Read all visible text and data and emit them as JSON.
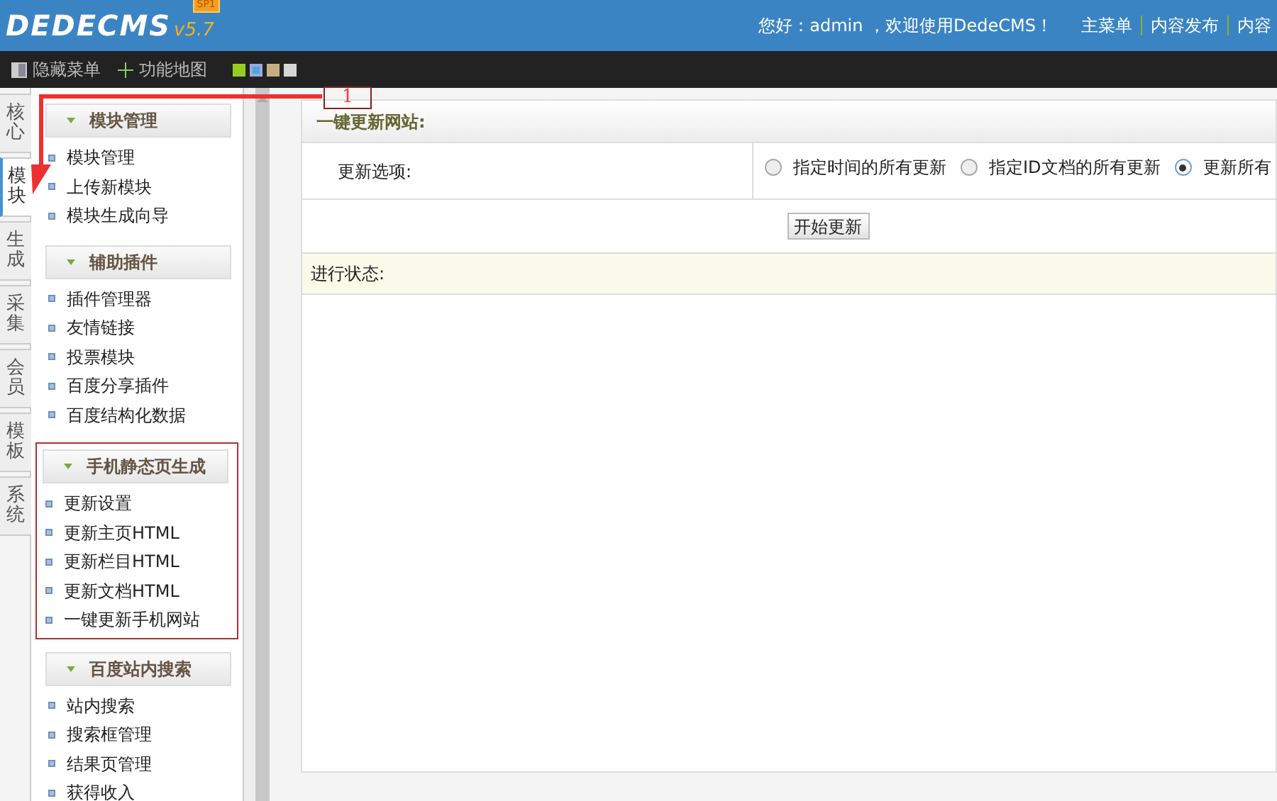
{
  "header": {
    "logo": "DEDECMS",
    "badge": "SP1",
    "version": "v5.7",
    "greeting": "您好：admin ，欢迎使用DedeCMS！",
    "nav": [
      "主菜单",
      "内容发布",
      "内容"
    ]
  },
  "toolbar": {
    "items": [
      {
        "label": "隐藏菜单",
        "kind": "hide"
      },
      {
        "label": "功能地图",
        "kind": "map"
      }
    ],
    "swatches": [
      {
        "color": "#99cc22",
        "selected": false
      },
      {
        "color": "#4aa6dc",
        "selected": true
      },
      {
        "color": "#c6ae84",
        "selected": false
      },
      {
        "color": "#d6d6d6",
        "selected": false
      }
    ]
  },
  "tabs": [
    {
      "label": "核心",
      "selected": false
    },
    {
      "label": "模块",
      "selected": true
    },
    {
      "label": "生成",
      "selected": false
    },
    {
      "label": "采集",
      "selected": false
    },
    {
      "label": "会员",
      "selected": false
    },
    {
      "label": "模板",
      "selected": false
    },
    {
      "label": "系统",
      "selected": false
    }
  ],
  "groups": [
    {
      "title": "模块管理",
      "highlighted": false,
      "items": [
        "模块管理",
        "上传新模块",
        "模块生成向导"
      ]
    },
    {
      "title": "辅助插件",
      "highlighted": false,
      "items": [
        "插件管理器",
        "友情链接",
        "投票模块",
        "百度分享插件",
        "百度结构化数据"
      ]
    },
    {
      "title": "手机静态页生成",
      "highlighted": true,
      "items": [
        "更新设置",
        "更新主页HTML",
        "更新栏目HTML",
        "更新文档HTML",
        "一键更新手机网站"
      ]
    },
    {
      "title": "百度站内搜索",
      "highlighted": false,
      "items": [
        "站内搜索",
        "搜索框管理",
        "结果页管理",
        "获得收入"
      ]
    }
  ],
  "main": {
    "title": "一键更新网站:",
    "option_label": "更新选项:",
    "options": [
      {
        "label": "指定时间的所有更新",
        "selected": false
      },
      {
        "label": "指定ID文档的所有更新",
        "selected": false
      },
      {
        "label": "更新所有",
        "selected": true
      }
    ],
    "button": "开始更新",
    "status_label": "进行状态:"
  },
  "annotation": {
    "label": "1"
  }
}
